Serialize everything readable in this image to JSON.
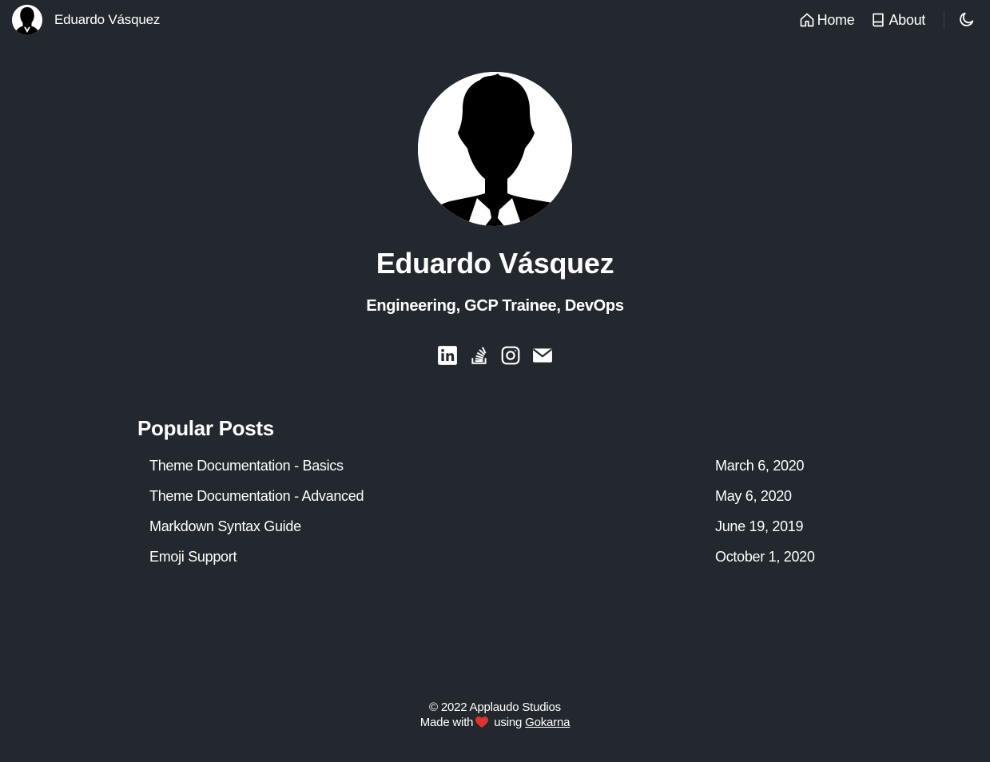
{
  "header": {
    "brand_name": "Eduardo Vásquez",
    "nav": [
      {
        "label": "Home",
        "icon": "home-icon"
      },
      {
        "label": "About",
        "icon": "book-icon"
      }
    ],
    "theme_toggle_icon": "moon-icon"
  },
  "intro": {
    "name": "Eduardo Vásquez",
    "tagline": "Engineering, GCP Trainee, DevOps",
    "social_icons": [
      "linkedin-icon",
      "stackoverflow-icon",
      "instagram-icon",
      "mail-icon"
    ]
  },
  "popular_posts": {
    "title": "Popular Posts",
    "items": [
      {
        "title": "Theme Documentation - Basics",
        "date": "March 6, 2020"
      },
      {
        "title": "Theme Documentation - Advanced",
        "date": "May 6, 2020"
      },
      {
        "title": "Markdown Syntax Guide",
        "date": "June 19, 2019"
      },
      {
        "title": "Emoji Support",
        "date": "October 1, 2020"
      }
    ]
  },
  "footer": {
    "copyright": "© 2022 Applaudo Studios",
    "made_with": "Made with",
    "using": "using",
    "link_label": "Gokarna"
  },
  "colors": {
    "background": "#23272e",
    "text": "#ffffff",
    "heart": "#e0322f"
  }
}
